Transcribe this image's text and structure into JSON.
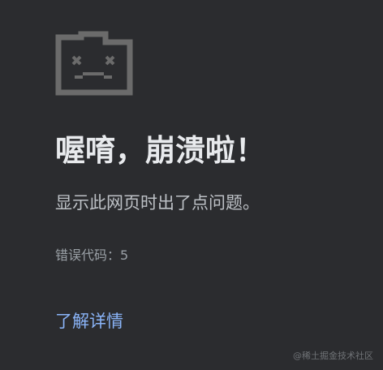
{
  "crash_page": {
    "icon": "sad-tab-icon",
    "title": "喔唷，崩溃啦！",
    "message": "显示此网页时出了点问题。",
    "error_code": "错误代码：5",
    "learn_more_label": "了解详情"
  },
  "watermark": "@稀土掘金技术社区",
  "colors": {
    "background": "#2b2c2f",
    "icon": "#6b6b6b",
    "title": "#e8eaed",
    "text": "#bdc1c6",
    "muted_text": "#9aa0a6",
    "link": "#8ab4f8"
  }
}
